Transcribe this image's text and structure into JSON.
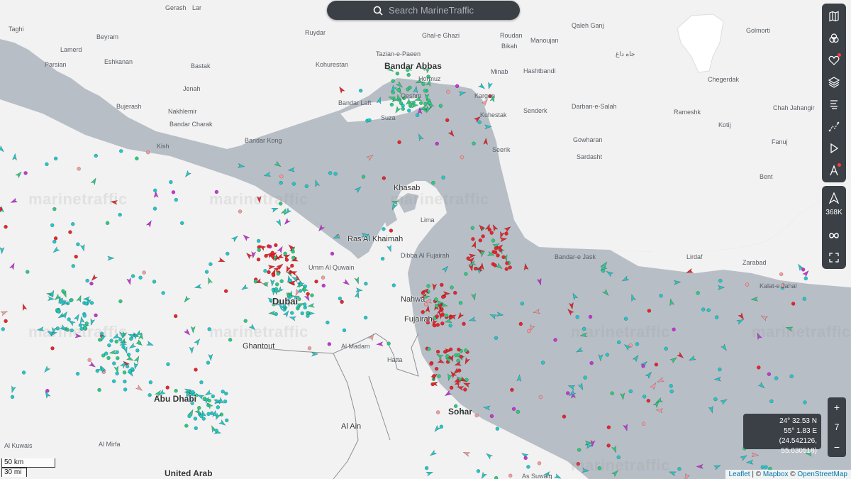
{
  "search": {
    "placeholder": "Search MarineTraffic"
  },
  "watermark": "marinetraffic",
  "places": {
    "large": [
      "Bandar Abbas",
      "Khasab",
      "Ras Al Khaimah",
      "Dubai",
      "Ghantout",
      "Abu Dhabi",
      "Sohar",
      "Al Ain",
      "United Arab",
      "Fujairah",
      "Nahwa",
      "Dibba Al Fujairah",
      "Umm Al Quwain"
    ],
    "small": [
      "Gerash",
      "Lar",
      "Taghi",
      "Beyram",
      "Ruydar",
      "Ghal-e Ghazi",
      "Roudan",
      "Manoujan",
      "Qaleh Ganj",
      "Golmorti",
      "Lamerd",
      "Tazian-e-Paeen",
      "Bikah",
      "Parsian",
      "Eshkanan",
      "Bastak",
      "Kohurestan",
      "Hormuz",
      "Minab",
      "Hashtbandi",
      "Jenah",
      "Qeshm",
      "Kargan",
      "Chegerdak",
      "Bujerash",
      "Nakhlemir",
      "Bandar Laft",
      "Kuhestak",
      "Senderk",
      "Darban-e-Salah",
      "Rameshk",
      "Chah Jahangir",
      "Bandar Charak",
      "Suza",
      "Kotij",
      "Bandar Kong",
      "Gowharan",
      "Fanuj",
      "Kish",
      "Seerik",
      "Sardasht",
      "Bent",
      "Lima",
      "Bandar-e Jask",
      "Lirdaf",
      "Zarabad",
      "Kalat-e Jahal",
      "Al Madam",
      "Hatta",
      "Al Mirfa",
      "Al Kuwais",
      "As Suwaiq",
      "جاه داغ"
    ]
  },
  "toolbar": {
    "top_icons": [
      "map-icon",
      "filter-icon",
      "heart-icon",
      "layers-icon",
      "weather-icon",
      "measure-icon",
      "play-icon",
      "account-icon"
    ],
    "vessel_count": "368K"
  },
  "zoom": {
    "plus": "+",
    "level": "7",
    "minus": "−"
  },
  "coords": {
    "lat": "24° 32.53 N",
    "lon": "55° 1.83 E",
    "decimal": "(24.542126, 55.030518)"
  },
  "scale": {
    "km": "50 km",
    "mi": "30 mi"
  },
  "attribution": {
    "leaflet": "Leaflet",
    "sep": " | © ",
    "mapbox": "Mapbox",
    "sep2": " © ",
    "osm": "OpenStreetMap"
  },
  "colors": {
    "sea": "#b8bec6",
    "land": "#f2f2f2",
    "cargo": "#2ec97f",
    "tanker": "#e8252b",
    "passenger": "#22c7c7",
    "pleasure": "#c435d6",
    "fishing": "#f49b9b"
  }
}
